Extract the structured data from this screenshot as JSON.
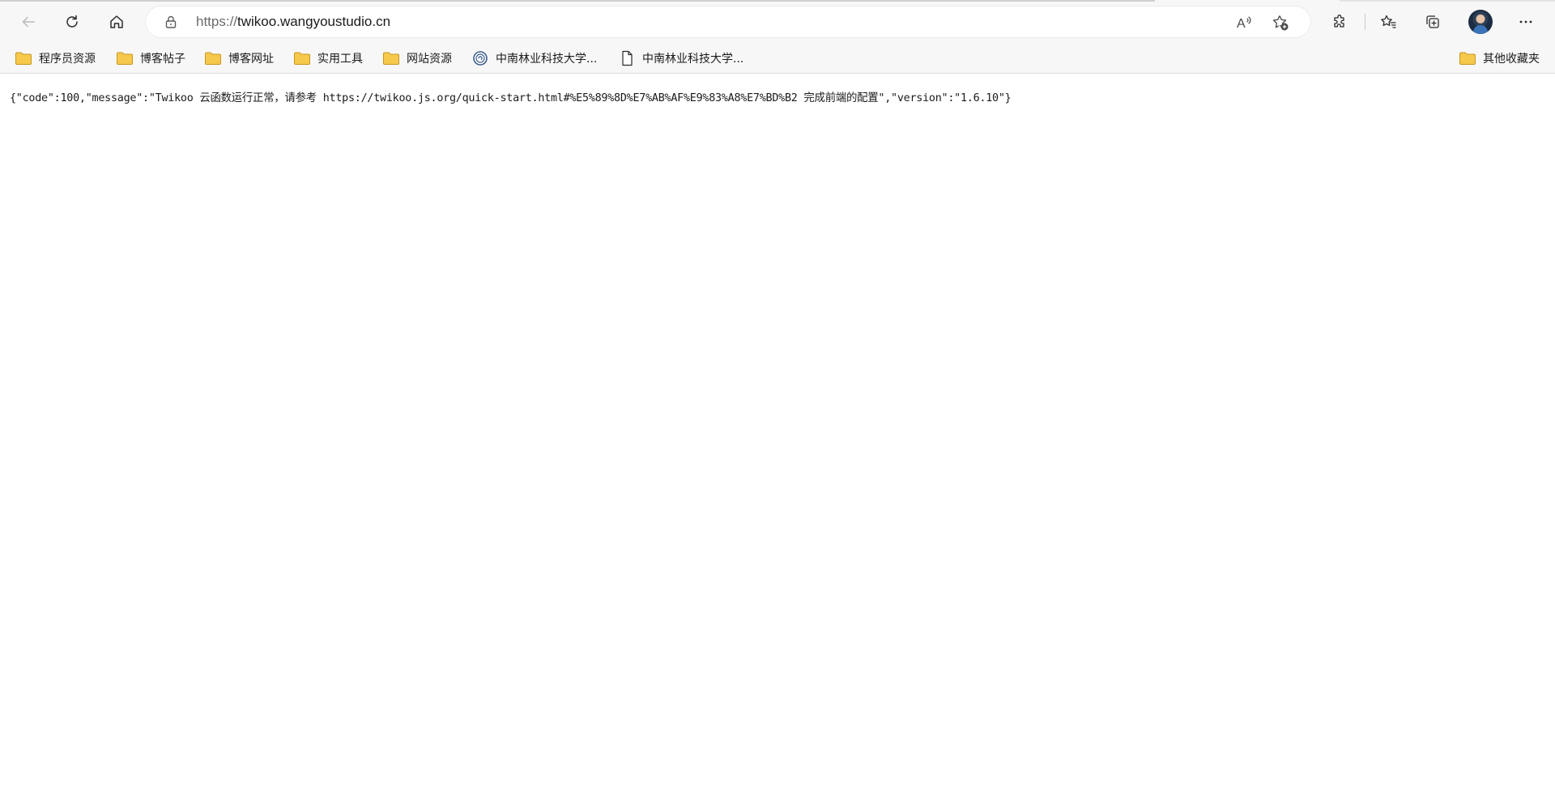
{
  "browser": {
    "address_bar": {
      "scheme": "https://",
      "host": "twikoo.wangyoustudio.cn"
    },
    "icons": {
      "back": "back-arrow-icon",
      "refresh": "refresh-icon",
      "home": "home-icon",
      "lock": "lock-icon",
      "read_aloud": "read-aloud-icon",
      "add_favorite": "add-favorite-icon",
      "extensions": "extensions-icon",
      "favorites": "favorites-icon",
      "collections": "collections-icon",
      "profile": "profile-avatar",
      "menu": "more-menu-icon"
    }
  },
  "bookmarks": {
    "items": [
      {
        "label": "程序员资源",
        "icon": "folder-icon"
      },
      {
        "label": "博客帖子",
        "icon": "folder-icon"
      },
      {
        "label": "博客网址",
        "icon": "folder-icon"
      },
      {
        "label": "实用工具",
        "icon": "folder-icon"
      },
      {
        "label": "网站资源",
        "icon": "folder-icon"
      },
      {
        "label": "中南林业科技大学...",
        "icon": "site-favicon-icon"
      },
      {
        "label": "中南林业科技大学...",
        "icon": "page-icon"
      }
    ],
    "other": {
      "label": "其他收藏夹",
      "icon": "folder-icon"
    }
  },
  "page": {
    "raw_json": "{\"code\":100,\"message\":\"Twikoo 云函数运行正常，请参考 https://twikoo.js.org/quick-start.html#%E5%89%8D%E7%AB%AF%E9%83%A8%E7%BD%B2 完成前端的配置\",\"version\":\"1.6.10\"}"
  },
  "colors": {
    "toolbar_bg": "#f7f7f7",
    "folder_fill": "#f6c94c",
    "folder_stroke": "#c9961c",
    "text": "#1b1b1b"
  }
}
